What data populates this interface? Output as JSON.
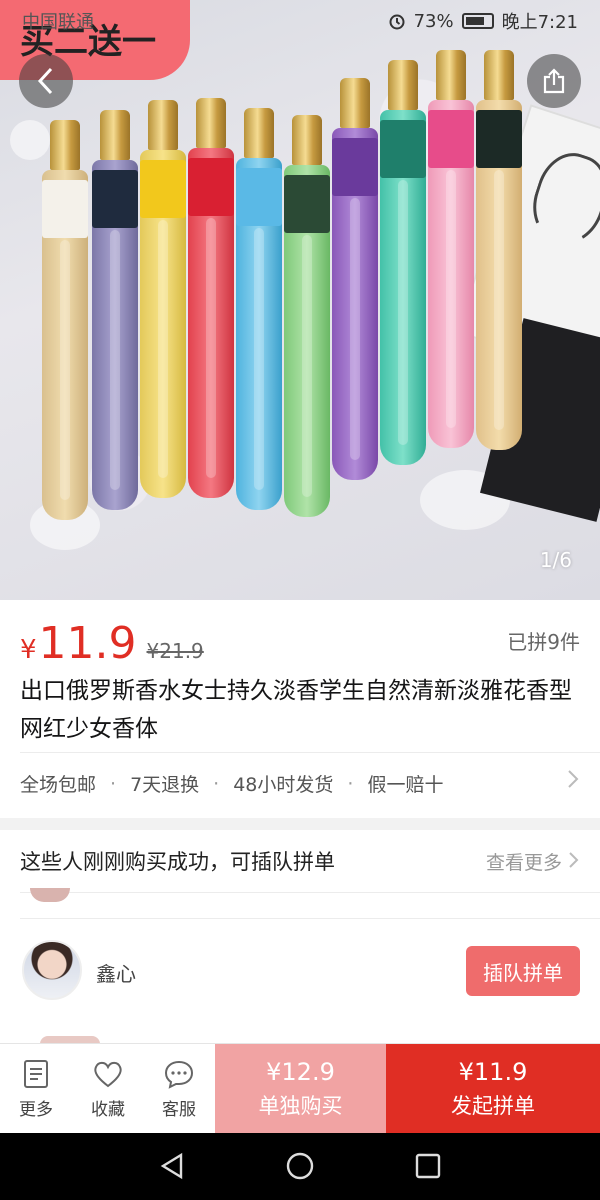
{
  "status_bar": {
    "carrier": "中国联通",
    "battery": "73%",
    "time": "晚上7:21"
  },
  "hero": {
    "promo_tag": "买二送一",
    "pager": "1/6"
  },
  "product": {
    "currency": "¥",
    "price": "11.9",
    "original_price": "¥21.9",
    "sold": "已拼9件",
    "title": "出口俄罗斯香水女士持久淡香学生自然清新淡雅花香型网红少女香体"
  },
  "services": [
    "全场包邮",
    "7天退换",
    "48小时发货",
    "假一赔十"
  ],
  "group": {
    "header": "这些人刚刚购买成功，可插队拼单",
    "see_more": "查看更多",
    "member_name": "鑫心",
    "join_label": "插队拼单"
  },
  "actions": {
    "more": "更多",
    "favorite": "收藏",
    "service": "客服",
    "single_price": "¥12.9",
    "single_label": "单独购买",
    "group_price": "¥11.9",
    "group_label": "发起拼单"
  },
  "colors": {
    "accent": "#e02e24",
    "single_bg": "#f1a3a3",
    "join_bg": "#ef6c6c"
  }
}
